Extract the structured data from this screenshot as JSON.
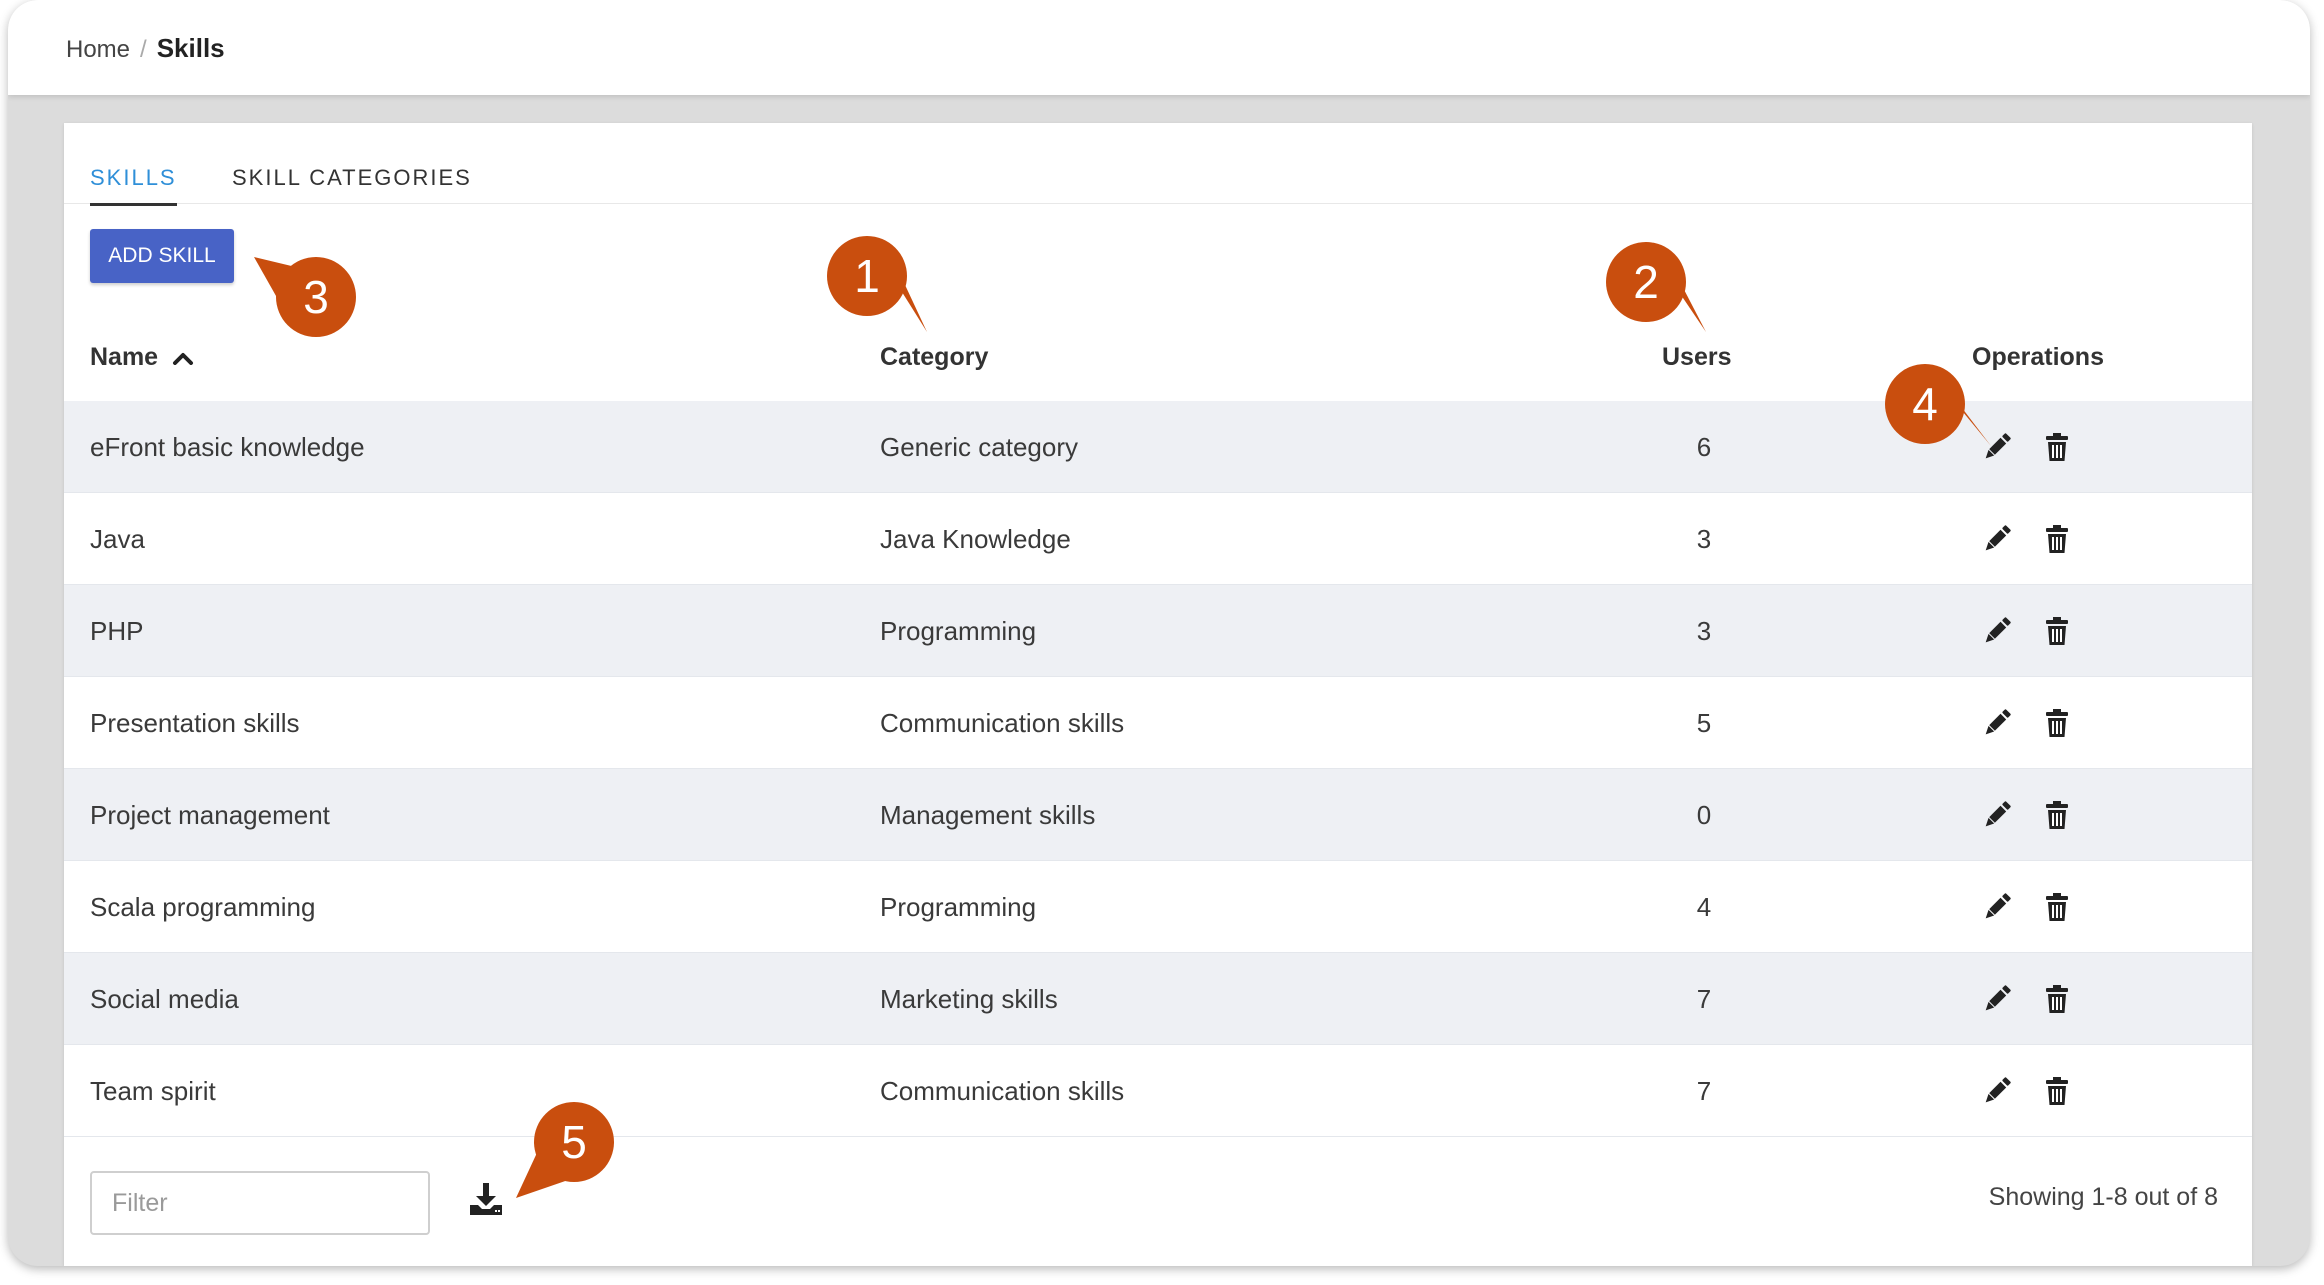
{
  "breadcrumb": {
    "home": "Home",
    "separator": "/",
    "current": "Skills"
  },
  "tabs": [
    {
      "label": "SKILLS",
      "active": true
    },
    {
      "label": "SKILL CATEGORIES",
      "active": false
    }
  ],
  "toolbar": {
    "add_label": "ADD SKILL"
  },
  "table": {
    "headers": {
      "name": "Name",
      "category": "Category",
      "users": "Users",
      "operations": "Operations"
    },
    "sort": {
      "column": "Name",
      "direction": "ascending"
    },
    "rows": [
      {
        "name": "eFront basic knowledge",
        "category": "Generic category",
        "users": "6"
      },
      {
        "name": "Java",
        "category": "Java Knowledge",
        "users": "3"
      },
      {
        "name": "PHP",
        "category": "Programming",
        "users": "3"
      },
      {
        "name": "Presentation skills",
        "category": "Communication skills",
        "users": "5"
      },
      {
        "name": "Project management",
        "category": "Management skills",
        "users": "0"
      },
      {
        "name": "Scala programming",
        "category": "Programming",
        "users": "4"
      },
      {
        "name": "Social media",
        "category": "Marketing skills",
        "users": "7"
      },
      {
        "name": "Team spirit",
        "category": "Communication skills",
        "users": "7"
      }
    ],
    "row_operations": [
      "pencil-icon",
      "trash-icon"
    ]
  },
  "footer": {
    "filter_placeholder": "Filter",
    "filter_value": "",
    "export_icon": "download-icon",
    "showing": "Showing 1-8 out of 8"
  },
  "callouts": [
    "1",
    "2",
    "3",
    "4",
    "5"
  ],
  "colors": {
    "accent": "#4863c6",
    "active_tab": "#2f8fd8",
    "callout": "#c94e0e",
    "row_stripe": "#eef0f4"
  }
}
